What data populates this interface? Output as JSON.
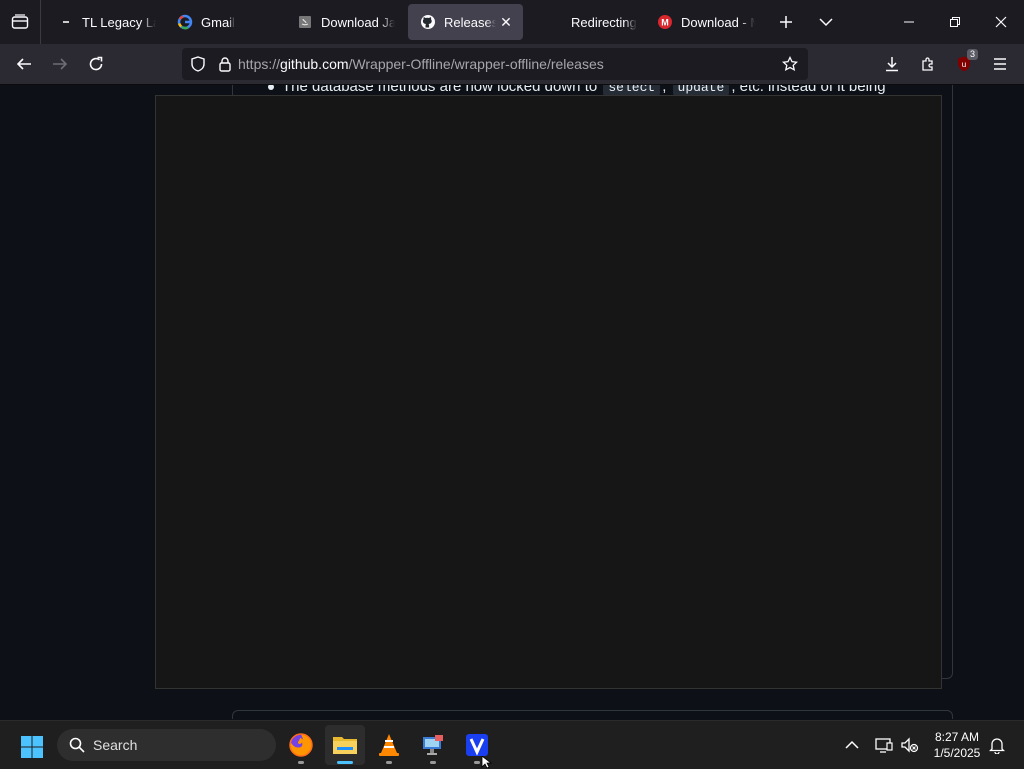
{
  "browser": {
    "tabs": [
      {
        "title": "TL Legacy Lau",
        "favicon": "dash-icon",
        "active": false
      },
      {
        "title": "Gmail",
        "favicon": "google-icon",
        "active": false
      },
      {
        "title": "Download Jav",
        "favicon": "java-icon",
        "active": false
      },
      {
        "title": "Releases · W",
        "favicon": "github-icon",
        "active": true
      },
      {
        "title": "Redirecting",
        "favicon": "none",
        "active": false
      },
      {
        "title": "Download - M",
        "favicon": "mega-icon",
        "active": false
      }
    ],
    "url_prefix": "https://",
    "url_host": "github.com",
    "url_path": "/Wrapper-Offline/wrapper-offline/releases",
    "extension_badge": "3"
  },
  "page": {
    "bullet_text_1": "The database methods are now locked down to",
    "code_1": "select",
    "sep": ",",
    "code_2": "update",
    "bullet_text_2": ", etc. instead of it being"
  },
  "taskbar": {
    "search_label": "Search",
    "apps": [
      "firefox-icon",
      "file-explorer-icon",
      "vlc-icon",
      "desktop-app-icon",
      "v-app-icon"
    ],
    "time": "8:27 AM",
    "date": "1/5/2025"
  },
  "colors": {
    "accent": "#4cc2ff",
    "page_bg": "#0d1117",
    "player_bg": "#161616"
  }
}
